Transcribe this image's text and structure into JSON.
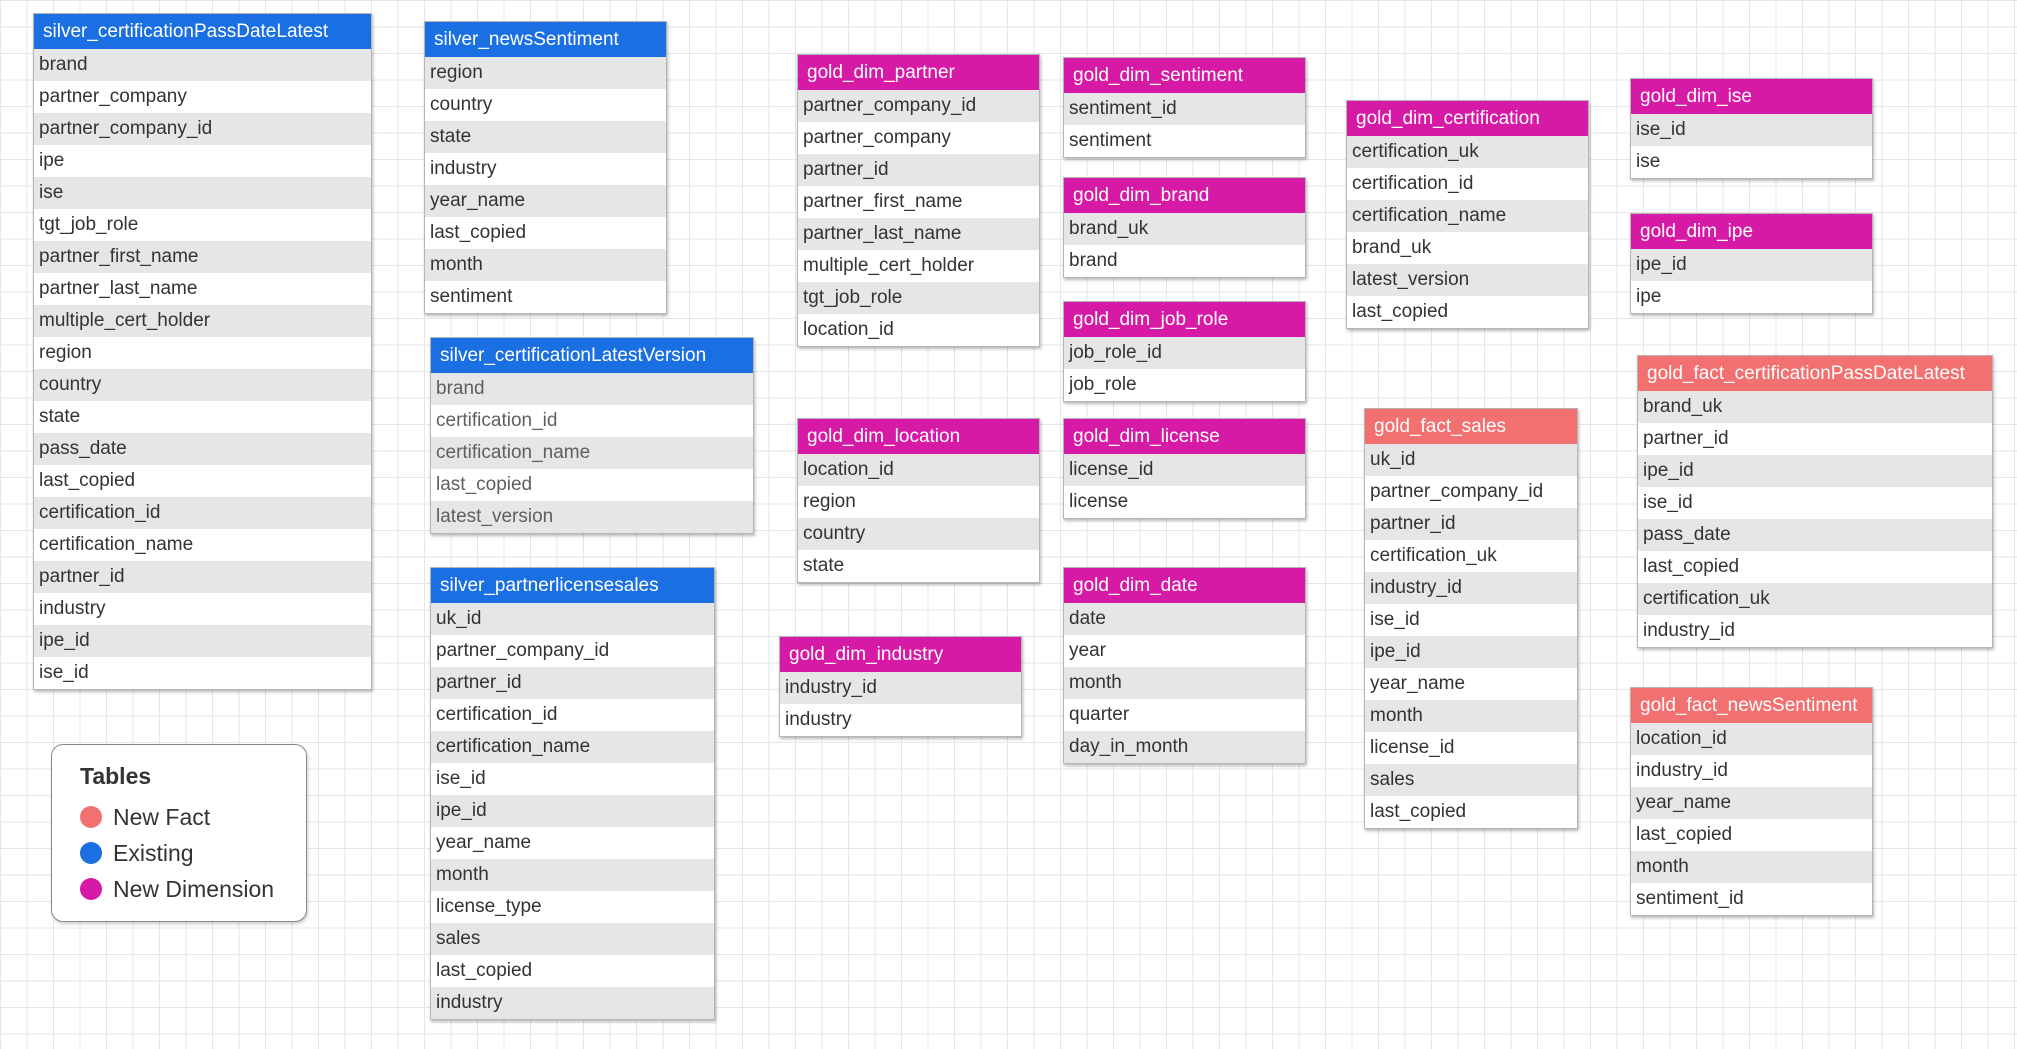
{
  "colors": {
    "existing": "#1a6fe3",
    "new_dimension": "#d71aa6",
    "new_fact": "#f2706f"
  },
  "legend": {
    "title": "Tables",
    "items": [
      {
        "label": "New Fact",
        "kind": "new_fact"
      },
      {
        "label": "Existing",
        "kind": "existing"
      },
      {
        "label": "New Dimension",
        "kind": "new_dimension"
      }
    ]
  },
  "tables": [
    {
      "name": "silver_certificationPassDateLatest",
      "kind": "existing",
      "fields": [
        "brand",
        "partner_company",
        "partner_company_id",
        "ipe",
        "ise",
        "tgt_job_role",
        "partner_first_name",
        "partner_last_name",
        "multiple_cert_holder",
        "region",
        "country",
        "state",
        "pass_date",
        "last_copied",
        "certification_id",
        "certification_name",
        "partner_id",
        "industry",
        "ipe_id",
        "ise_id"
      ]
    },
    {
      "name": "silver_newsSentiment",
      "kind": "existing",
      "fields": [
        "region",
        "country",
        "state",
        "industry",
        "year_name",
        "last_copied",
        "month",
        "sentiment"
      ]
    },
    {
      "name": "silver_certificationLatestVersion",
      "kind": "existing",
      "fields": [
        "brand",
        "certification_id",
        "certification_name",
        "last_copied",
        "latest_version"
      ]
    },
    {
      "name": "silver_partnerlicensesales",
      "kind": "existing",
      "fields": [
        "uk_id",
        "partner_company_id",
        "partner_id",
        "certification_id",
        "certification_name",
        "ise_id",
        "ipe_id",
        "year_name",
        "month",
        "license_type",
        "sales",
        "last_copied",
        "industry"
      ]
    },
    {
      "name": "gold_dim_partner",
      "kind": "new_dimension",
      "fields": [
        "partner_company_id",
        "partner_company",
        "partner_id",
        "partner_first_name",
        "partner_last_name",
        "multiple_cert_holder",
        "tgt_job_role",
        "location_id"
      ]
    },
    {
      "name": "gold_dim_location",
      "kind": "new_dimension",
      "fields": [
        "location_id",
        "region",
        "country",
        "state"
      ]
    },
    {
      "name": "gold_dim_industry",
      "kind": "new_dimension",
      "fields": [
        "industry_id",
        "industry"
      ]
    },
    {
      "name": "gold_dim_sentiment",
      "kind": "new_dimension",
      "fields": [
        "sentiment_id",
        "sentiment"
      ]
    },
    {
      "name": "gold_dim_brand",
      "kind": "new_dimension",
      "fields": [
        "brand_uk",
        "brand"
      ]
    },
    {
      "name": "gold_dim_job_role",
      "kind": "new_dimension",
      "fields": [
        "job_role_id",
        "job_role"
      ]
    },
    {
      "name": "gold_dim_license",
      "kind": "new_dimension",
      "fields": [
        "license_id",
        "license"
      ]
    },
    {
      "name": "gold_dim_date",
      "kind": "new_dimension",
      "fields": [
        "date",
        "year",
        "month",
        "quarter",
        "day_in_month"
      ]
    },
    {
      "name": "gold_dim_certification",
      "kind": "new_dimension",
      "fields": [
        "certification_uk",
        "certification_id",
        "certification_name",
        "brand_uk",
        "latest_version",
        "last_copied"
      ]
    },
    {
      "name": "gold_fact_sales",
      "kind": "new_fact",
      "fields": [
        "uk_id",
        "partner_company_id",
        "partner_id",
        "certification_uk",
        "industry_id",
        "ise_id",
        "ipe_id",
        "year_name",
        "month",
        "license_id",
        "sales",
        "last_copied"
      ]
    },
    {
      "name": "gold_dim_ise",
      "kind": "new_dimension",
      "fields": [
        "ise_id",
        "ise"
      ]
    },
    {
      "name": "gold_dim_ipe",
      "kind": "new_dimension",
      "fields": [
        "ipe_id",
        "ipe"
      ]
    },
    {
      "name": "gold_fact_certificationPassDateLatest",
      "kind": "new_fact",
      "fields": [
        "brand_uk",
        "partner_id",
        "ipe_id",
        "ise_id",
        "pass_date",
        "last_copied",
        "certification_uk",
        "industry_id"
      ]
    },
    {
      "name": "gold_fact_newsSentiment",
      "kind": "new_fact",
      "fields": [
        "location_id",
        "industry_id",
        "year_name",
        "last_copied",
        "month",
        "sentiment_id"
      ]
    }
  ]
}
